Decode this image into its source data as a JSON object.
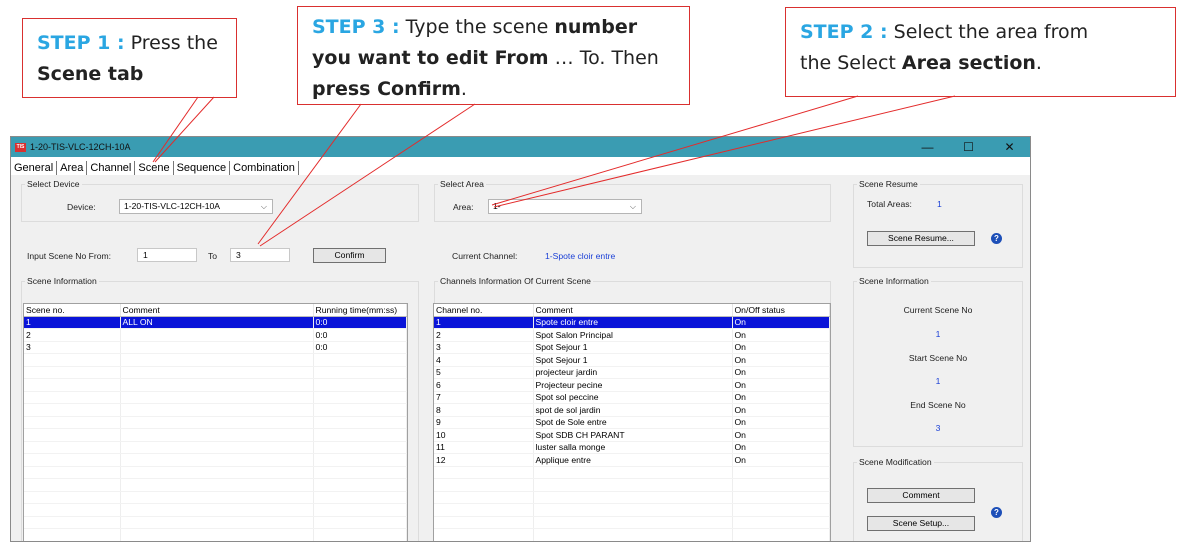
{
  "callouts": {
    "step1": {
      "step": "STEP 1 :",
      "text1": "Press the",
      "bold": "Scene tab"
    },
    "step3": {
      "step": "STEP 3 :",
      "text1": "Type the scene",
      "bold1": "number",
      "bold2": "you want to edit From",
      "text2": "… To. Then",
      "bold3": "press Confirm",
      "text3": "."
    },
    "step2": {
      "step": "STEP 2 :",
      "text1": "Select the area from",
      "text2": "the Select",
      "bold": "Area section",
      "text3": "."
    }
  },
  "window": {
    "title": "1-20-TIS-VLC-12CH-10A",
    "app_icon": "TIS",
    "controls": {
      "minimize": "—",
      "maximize": "☐",
      "close": "✕"
    }
  },
  "tabs": [
    "General",
    "Area",
    "Channel",
    "Scene",
    "Sequence",
    "Combination"
  ],
  "select_device": {
    "title": "Select Device",
    "label": "Device:",
    "value": "1-20-TIS-VLC-12CH-10A"
  },
  "select_area": {
    "title": "Select Area",
    "label": "Area:",
    "value": "1-"
  },
  "scene_input": {
    "from_label": "Input Scene No From:",
    "from_value": "1",
    "to_label": "To",
    "to_value": "3",
    "confirm": "Confirm"
  },
  "current_channel": {
    "label": "Current Channel:",
    "value": "1-Spote cloir entre"
  },
  "scene_info": {
    "title": "Scene Information",
    "columns": [
      "Scene no.",
      "Comment",
      "Running time(mm:ss)"
    ],
    "rows": [
      [
        "1",
        "ALL ON",
        "0:0"
      ],
      [
        "2",
        "",
        "0:0"
      ],
      [
        "3",
        "",
        "0:0"
      ]
    ]
  },
  "channels_info": {
    "title": "Channels Information Of Current Scene",
    "columns": [
      "Channel no.",
      "Comment",
      "On/Off status"
    ],
    "rows": [
      [
        "1",
        "Spote cloir entre",
        "On"
      ],
      [
        "2",
        "Spot Salon Principal",
        "On"
      ],
      [
        "3",
        "Spot Sejour 1",
        "On"
      ],
      [
        "4",
        "Spot Sejour 1",
        "On"
      ],
      [
        "5",
        "projecteur jardin",
        "On"
      ],
      [
        "6",
        "Projecteur pecine",
        "On"
      ],
      [
        "7",
        "Spot sol peccine",
        "On"
      ],
      [
        "8",
        "spot de sol jardin",
        "On"
      ],
      [
        "9",
        "Spot de Sole entre",
        "On"
      ],
      [
        "10",
        "Spot SDB CH PARANT",
        "On"
      ],
      [
        "11",
        "luster salla monge",
        "On"
      ],
      [
        "12",
        "Applique entre",
        "On"
      ]
    ]
  },
  "scene_resume": {
    "title": "Scene Resume",
    "total_label": "Total Areas:",
    "total_value": "1",
    "button": "Scene Resume..."
  },
  "scene_information_right": {
    "title": "Scene Information",
    "current_label": "Current Scene No",
    "current_value": "1",
    "start_label": "Start Scene No",
    "start_value": "1",
    "end_label": "End Scene No",
    "end_value": "3"
  },
  "scene_modification": {
    "title": "Scene Modification",
    "comment_button": "Comment",
    "setup_button": "Scene Setup..."
  },
  "help_glyph": "?",
  "colors": {
    "accent_blue": "#2aa6e2",
    "callout_border": "#d9302f",
    "titlebar": "#3a9cb2",
    "selection": "#0a14d8"
  }
}
